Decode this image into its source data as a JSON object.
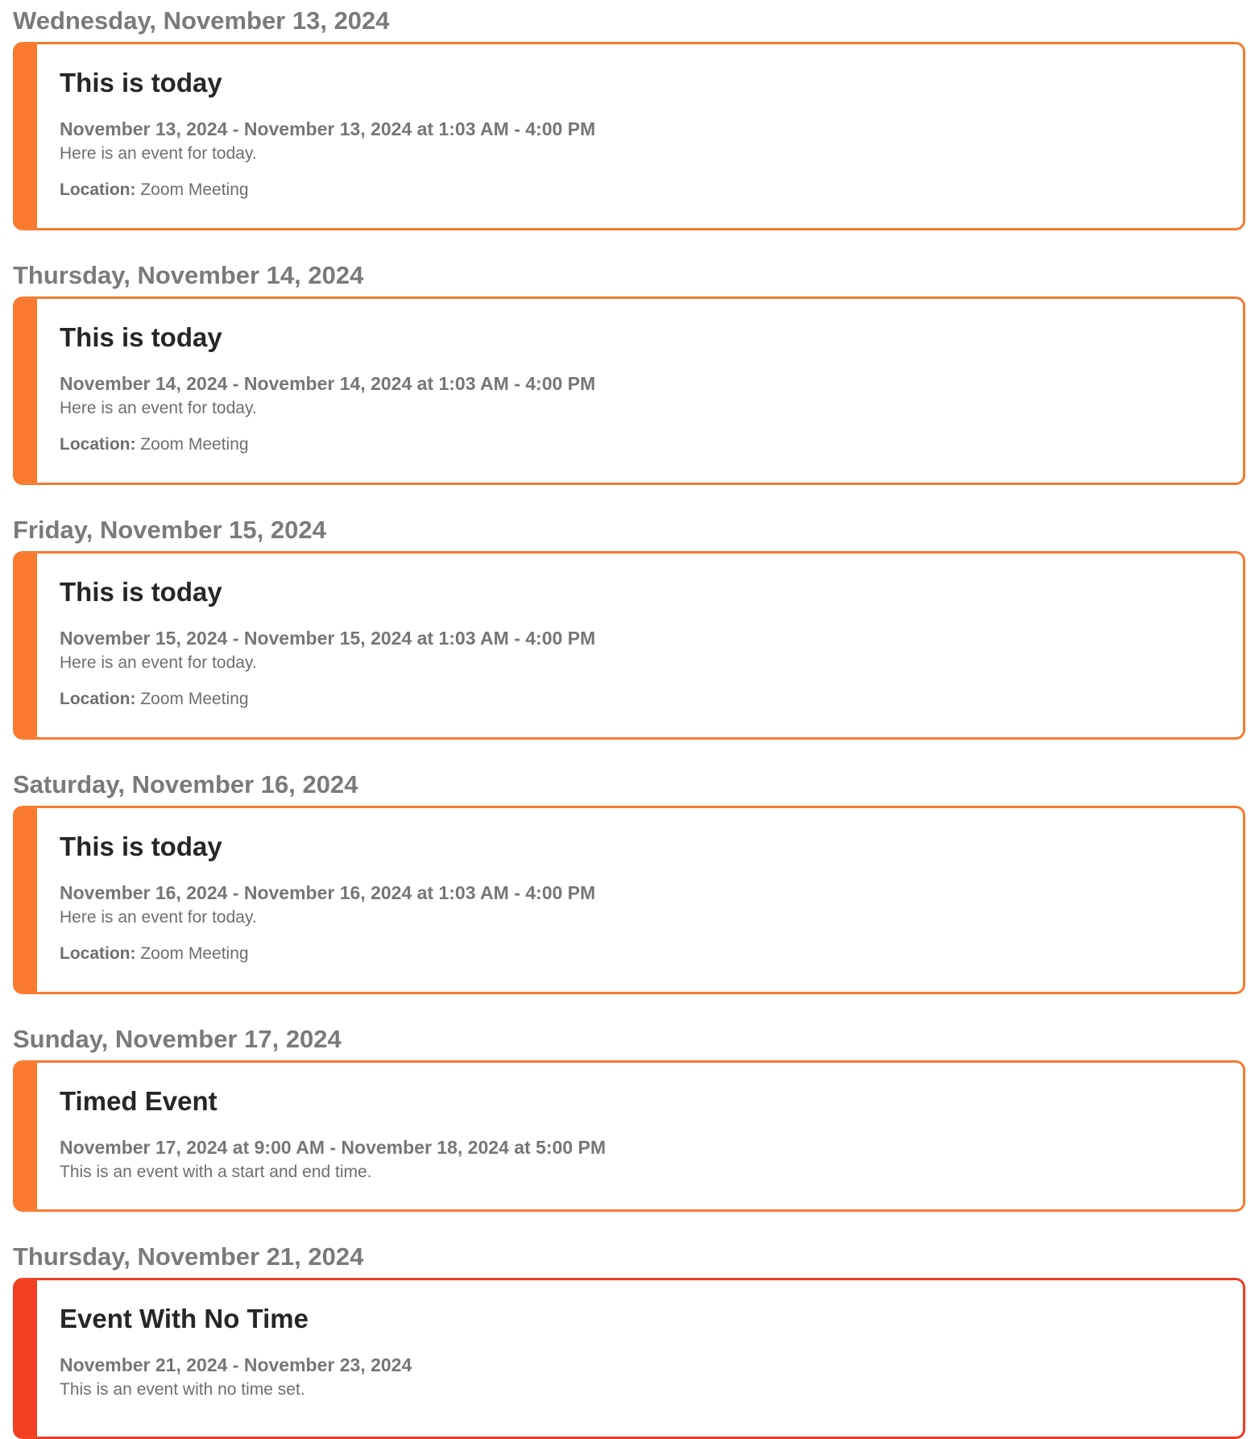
{
  "colors": {
    "accent_orange": "#f97a2f",
    "accent_red": "#f23f22",
    "heading_gray": "#7a7a7a"
  },
  "days": [
    {
      "heading": "Wednesday, November 13, 2024",
      "event": {
        "title": "This is today",
        "dates": "November 13, 2024 - November 13, 2024 at 1:03 AM - 4:00 PM",
        "description": "Here is an event for today.",
        "location_label": "Location:",
        "location": "Zoom Meeting"
      }
    },
    {
      "heading": "Thursday, November 14, 2024",
      "event": {
        "title": "This is today",
        "dates": "November 14, 2024 - November 14, 2024 at 1:03 AM - 4:00 PM",
        "description": "Here is an event for today.",
        "location_label": "Location:",
        "location": "Zoom Meeting"
      }
    },
    {
      "heading": "Friday, November 15, 2024",
      "event": {
        "title": "This is today",
        "dates": "November 15, 2024 - November 15, 2024 at 1:03 AM - 4:00 PM",
        "description": "Here is an event for today.",
        "location_label": "Location:",
        "location": "Zoom Meeting"
      }
    },
    {
      "heading": "Saturday, November 16, 2024",
      "event": {
        "title": "This is today",
        "dates": "November 16, 2024 - November 16, 2024 at 1:03 AM - 4:00 PM",
        "description": "Here is an event for today.",
        "location_label": "Location:",
        "location": "Zoom Meeting"
      }
    },
    {
      "heading": "Sunday, November 17, 2024",
      "event": {
        "title": "Timed Event",
        "dates": "November 17, 2024 at 9:00 AM - November 18, 2024 at 5:00 PM",
        "description": "This is an event with a start and end time."
      }
    },
    {
      "heading": "Thursday, November 21, 2024",
      "event": {
        "title": "Event With No Time",
        "dates": "November 21, 2024 - November 23, 2024",
        "description": "This is an event with no time set."
      }
    }
  ]
}
